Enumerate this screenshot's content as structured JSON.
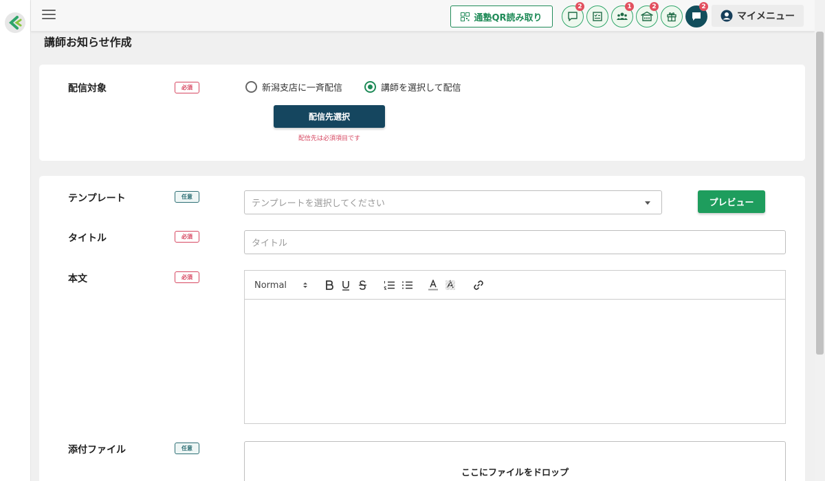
{
  "header": {
    "qr_button_label": "通塾QR読み取り",
    "icons": [
      {
        "name": "chat-icon",
        "badge": "2"
      },
      {
        "name": "checklist-icon",
        "badge": ""
      },
      {
        "name": "group-icon",
        "badge": "1"
      },
      {
        "name": "school-icon",
        "badge": "2"
      },
      {
        "name": "gift-icon",
        "badge": ""
      },
      {
        "name": "message-icon",
        "badge": "2"
      }
    ],
    "my_menu_label": "マイメニュー"
  },
  "page": {
    "title": "講師お知らせ作成"
  },
  "badges": {
    "required": "必須",
    "optional": "任意"
  },
  "delivery": {
    "label": "配信対象",
    "option_all": "新潟支店に一斉配信",
    "option_select": "講師を選択して配信",
    "selected": "option_select",
    "select_button": "配信先選択",
    "error": "配信先は必須項目です"
  },
  "form": {
    "template_label": "テンプレート",
    "template_placeholder": "テンプレートを選択してください",
    "preview_button": "プレビュー",
    "title_label": "タイトル",
    "title_placeholder": "タイトル",
    "body_label": "本文",
    "editor_format": "Normal",
    "attachment_label": "添付ファイル",
    "dropzone_text": "ここにファイルをドロップ"
  },
  "colors": {
    "accent_green": "#1e9d5d",
    "primary_navy": "#15465f",
    "required_red": "#d6455f",
    "optional_teal": "#2b6d73"
  }
}
